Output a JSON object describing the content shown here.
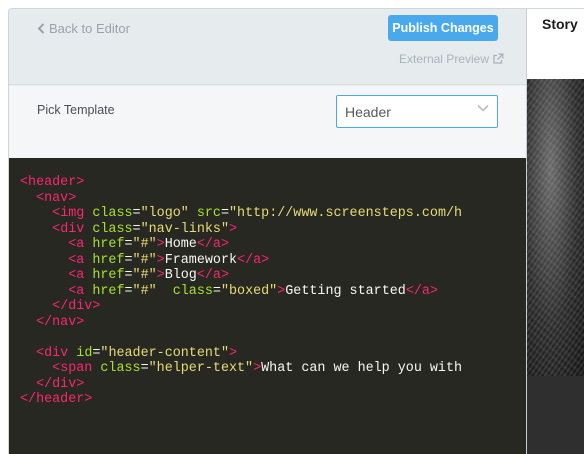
{
  "toolbar": {
    "back_label": "Back to Editor",
    "publish_label": "Publish Changes",
    "external_preview_label": "External Preview"
  },
  "template_picker": {
    "label": "Pick Template",
    "selected": "Header"
  },
  "code_lines": [
    {
      "indent": "",
      "segments": [
        {
          "t": "tag",
          "v": "<header>"
        }
      ]
    },
    {
      "indent": "  ",
      "segments": [
        {
          "t": "tag",
          "v": "<nav>"
        }
      ]
    },
    {
      "indent": "    ",
      "segments": [
        {
          "t": "tag",
          "v": "<img"
        },
        {
          "t": "text",
          "v": " "
        },
        {
          "t": "attr",
          "v": "class"
        },
        {
          "t": "text",
          "v": "="
        },
        {
          "t": "str",
          "v": "\"logo\""
        },
        {
          "t": "text",
          "v": " "
        },
        {
          "t": "attr",
          "v": "src"
        },
        {
          "t": "text",
          "v": "="
        },
        {
          "t": "str",
          "v": "\"http://www.screensteps.com/h"
        }
      ]
    },
    {
      "indent": "    ",
      "segments": [
        {
          "t": "tag",
          "v": "<div"
        },
        {
          "t": "text",
          "v": " "
        },
        {
          "t": "attr",
          "v": "class"
        },
        {
          "t": "text",
          "v": "="
        },
        {
          "t": "str",
          "v": "\"nav-links\""
        },
        {
          "t": "tag",
          "v": ">"
        }
      ]
    },
    {
      "indent": "      ",
      "segments": [
        {
          "t": "tag",
          "v": "<a"
        },
        {
          "t": "text",
          "v": " "
        },
        {
          "t": "attr",
          "v": "href"
        },
        {
          "t": "text",
          "v": "="
        },
        {
          "t": "str",
          "v": "\"#\""
        },
        {
          "t": "tag",
          "v": ">"
        },
        {
          "t": "text",
          "v": "Home"
        },
        {
          "t": "tag",
          "v": "</a>"
        }
      ]
    },
    {
      "indent": "      ",
      "segments": [
        {
          "t": "tag",
          "v": "<a"
        },
        {
          "t": "text",
          "v": " "
        },
        {
          "t": "attr",
          "v": "href"
        },
        {
          "t": "text",
          "v": "="
        },
        {
          "t": "str",
          "v": "\"#\""
        },
        {
          "t": "tag",
          "v": ">"
        },
        {
          "t": "text",
          "v": "Framework"
        },
        {
          "t": "tag",
          "v": "</a>"
        }
      ]
    },
    {
      "indent": "      ",
      "segments": [
        {
          "t": "tag",
          "v": "<a"
        },
        {
          "t": "text",
          "v": " "
        },
        {
          "t": "attr",
          "v": "href"
        },
        {
          "t": "text",
          "v": "="
        },
        {
          "t": "str",
          "v": "\"#\""
        },
        {
          "t": "tag",
          "v": ">"
        },
        {
          "t": "text",
          "v": "Blog"
        },
        {
          "t": "tag",
          "v": "</a>"
        }
      ]
    },
    {
      "indent": "      ",
      "segments": [
        {
          "t": "tag",
          "v": "<a"
        },
        {
          "t": "text",
          "v": " "
        },
        {
          "t": "attr",
          "v": "href"
        },
        {
          "t": "text",
          "v": "="
        },
        {
          "t": "str",
          "v": "\"#\""
        },
        {
          "t": "text",
          "v": "  "
        },
        {
          "t": "attr",
          "v": "class"
        },
        {
          "t": "text",
          "v": "="
        },
        {
          "t": "str",
          "v": "\"boxed\""
        },
        {
          "t": "tag",
          "v": ">"
        },
        {
          "t": "text",
          "v": "Getting started"
        },
        {
          "t": "tag",
          "v": "</a>"
        }
      ]
    },
    {
      "indent": "    ",
      "segments": [
        {
          "t": "tag",
          "v": "</div>"
        }
      ]
    },
    {
      "indent": "  ",
      "segments": [
        {
          "t": "tag",
          "v": "</nav>"
        }
      ]
    },
    {
      "indent": "",
      "segments": []
    },
    {
      "indent": "  ",
      "segments": [
        {
          "t": "tag",
          "v": "<div"
        },
        {
          "t": "text",
          "v": " "
        },
        {
          "t": "attr",
          "v": "id"
        },
        {
          "t": "text",
          "v": "="
        },
        {
          "t": "str",
          "v": "\"header-content\""
        },
        {
          "t": "tag",
          "v": ">"
        }
      ]
    },
    {
      "indent": "    ",
      "segments": [
        {
          "t": "tag",
          "v": "<span"
        },
        {
          "t": "text",
          "v": " "
        },
        {
          "t": "attr",
          "v": "class"
        },
        {
          "t": "text",
          "v": "="
        },
        {
          "t": "str",
          "v": "\"helper-text\""
        },
        {
          "t": "tag",
          "v": ">"
        },
        {
          "t": "text",
          "v": "What can we help you with"
        }
      ]
    },
    {
      "indent": "  ",
      "segments": [
        {
          "t": "tag",
          "v": "</div>"
        }
      ]
    },
    {
      "indent": "",
      "segments": [
        {
          "t": "tag",
          "v": "</header>"
        }
      ]
    }
  ],
  "preview": {
    "title": "Story"
  },
  "colors": {
    "accent": "#4aa9ed",
    "code_bg": "#272822",
    "tag": "#f92672",
    "attr": "#a6e22e",
    "string": "#e6db74",
    "text": "#f8f8f2"
  },
  "icons": {
    "back": "chevron-left-icon",
    "external": "external-link-icon",
    "dropdown": "chevron-down-icon"
  }
}
